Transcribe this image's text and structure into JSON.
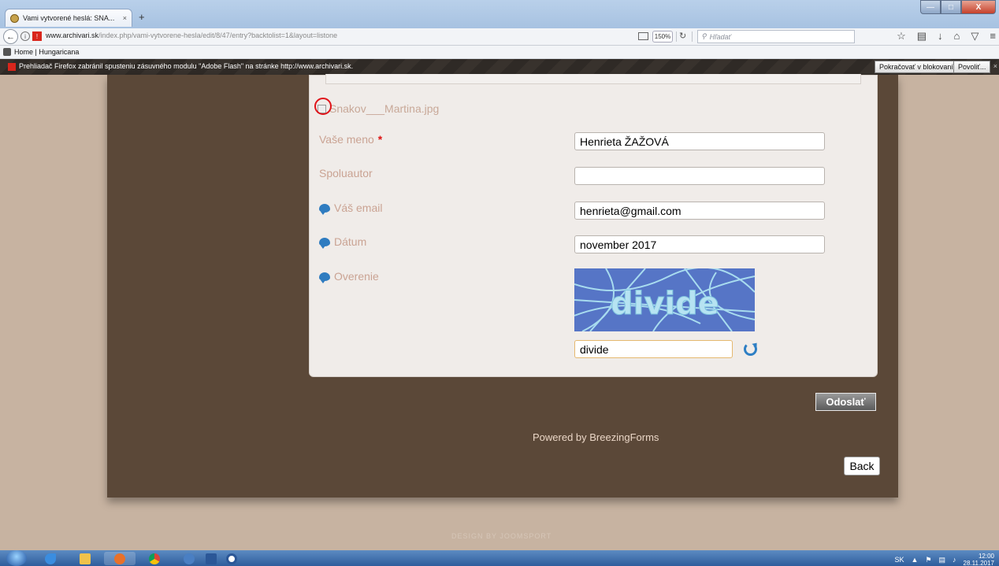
{
  "browser": {
    "tab_title": "Vami vytvorené heslá: SNA...",
    "tab_close": "×",
    "new_tab": "+",
    "url_host": "www.archivari.sk",
    "url_path": "/index.php/vami-vytvorene-hesla/edit/8/47/entry?backtolist=1&layout=listone",
    "zoom": "150%",
    "search_placeholder": "Hľadať",
    "bookmark": "Home | Hungaricana",
    "window_buttons": {
      "minimize": "—",
      "maximize": "□",
      "close": "X"
    }
  },
  "flash_bar": {
    "message": "Prehliadač Firefox zabránil spusteniu zásuvného modulu \"Adobe Flash\" na stránke http://www.archivari.sk.",
    "keep_blocking": "Pokračovať v blokovaní",
    "allow": "Povoliť...",
    "close": "×"
  },
  "form": {
    "file_name": "Snakov___Martina.jpg",
    "fields": {
      "name": {
        "label": "Vaše meno",
        "required_mark": "*",
        "value": "Henrieta ŽAŽOVÁ"
      },
      "coauthor": {
        "label": "Spoluautor",
        "value": ""
      },
      "email": {
        "label": "Váš email",
        "value": "henrieta@gmail.com"
      },
      "date": {
        "label": "Dátum",
        "value": "november 2017"
      },
      "verification": {
        "label": "Overenie",
        "captcha_text": "divide",
        "value": "divide"
      }
    },
    "submit": "Odoslať",
    "powered_by": "Powered by BreezingForms",
    "back": "Back",
    "design_credit": "DESIGN BY JOOMSPORT"
  },
  "taskbar": {
    "language": "SK",
    "time": "12:00",
    "date": "28.11.2017"
  }
}
